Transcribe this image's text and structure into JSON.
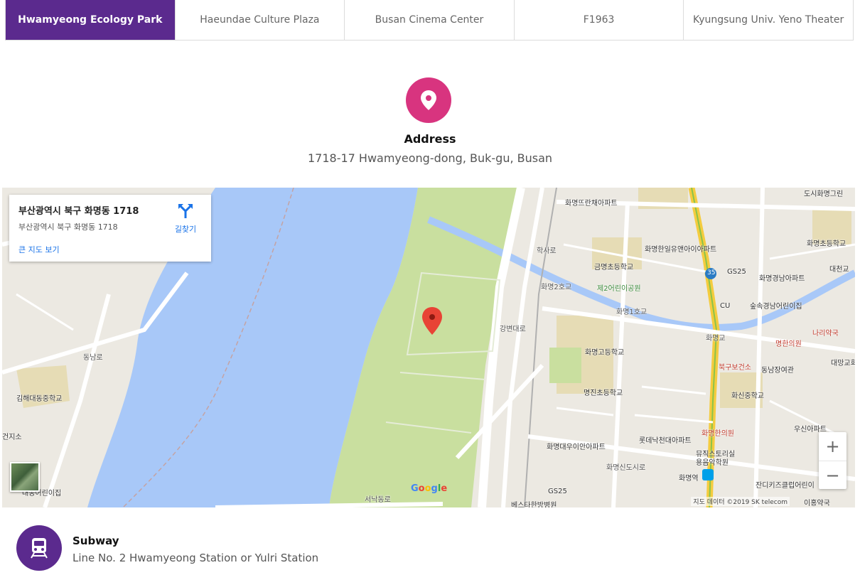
{
  "tabs": [
    {
      "label": "Hwamyeong Ecology Park",
      "active": true
    },
    {
      "label": "Haeundae Culture Plaza",
      "active": false
    },
    {
      "label": "Busan Cinema Center",
      "active": false
    },
    {
      "label": "F1963",
      "active": false
    },
    {
      "label": "Kyungsung Univ. Yeno Theater",
      "active": false
    }
  ],
  "address": {
    "icon": "location-pin-icon",
    "title": "Address",
    "text": "1718-17 Hwamyeong-dong, Buk-gu, Busan"
  },
  "map": {
    "info": {
      "title": "부산광역시 북구 화명동 1718",
      "subtitle": "부산광역시 북구 화명동 1718",
      "directions_label": "길찾기",
      "larger_map_link": "큰 지도 보기"
    },
    "labels": {
      "l1": "도시화명그린",
      "l2": "화명뜨란채아파트",
      "l3": "화명초등학교",
      "l4": "화명한일유앤아이아파트",
      "l5": "대천교",
      "l6": "금명초등학교",
      "l7": "GS25",
      "l8": "화명경남아파트",
      "l9": "화명2호교",
      "l10": "제2어린이공원",
      "l11": "숲속경남어린이집",
      "l12": "CU",
      "l13": "화명1호교",
      "l14": "나리약국",
      "l15": "화명교",
      "l16": "명한의원",
      "l17": "화명고등학교",
      "l18": "북구보건소",
      "l19": "동남장여관",
      "l20": "대망교회",
      "l21": "명진초등학교",
      "l22": "화신중학교",
      "l23": "김해대동중학교",
      "l24": "우신아파트",
      "l25": "롯데낙천대아파트",
      "l26": "화명대우이안아파트",
      "l27": "화명한의원",
      "l28": "뮤직스토리실용음악학원",
      "l29": "화명역",
      "l30": "잔디키즈클럽어린이",
      "l31": "GS25",
      "l32": "베스타한방병원",
      "l33": "서낙동로",
      "l34": "강변대로",
      "l35": "건지소",
      "l36": "대동어린이집",
      "l37": "동남로",
      "l38": "학사로",
      "l39": "화명신도시로",
      "l40": "이홍약국",
      "l41": "35"
    },
    "google_logo": [
      "G",
      "o",
      "o",
      "g",
      "l",
      "e"
    ],
    "google_colors": [
      "#4285F4",
      "#EA4335",
      "#FBBC05",
      "#4285F4",
      "#34A853",
      "#EA4335"
    ],
    "attribution": "지도 데이터 ©2019 SK telecom",
    "zoom_in": "+",
    "zoom_out": "−"
  },
  "subway": {
    "icon": "subway-train-icon",
    "title": "Subway",
    "text": "Line No. 2 Hwamyeong Station or Yulri Station"
  },
  "colors": {
    "accent_purple": "#5b2a8e",
    "pin_pink": "#d8347f",
    "river": "#a8c8f8",
    "park": "#c9df9f"
  }
}
